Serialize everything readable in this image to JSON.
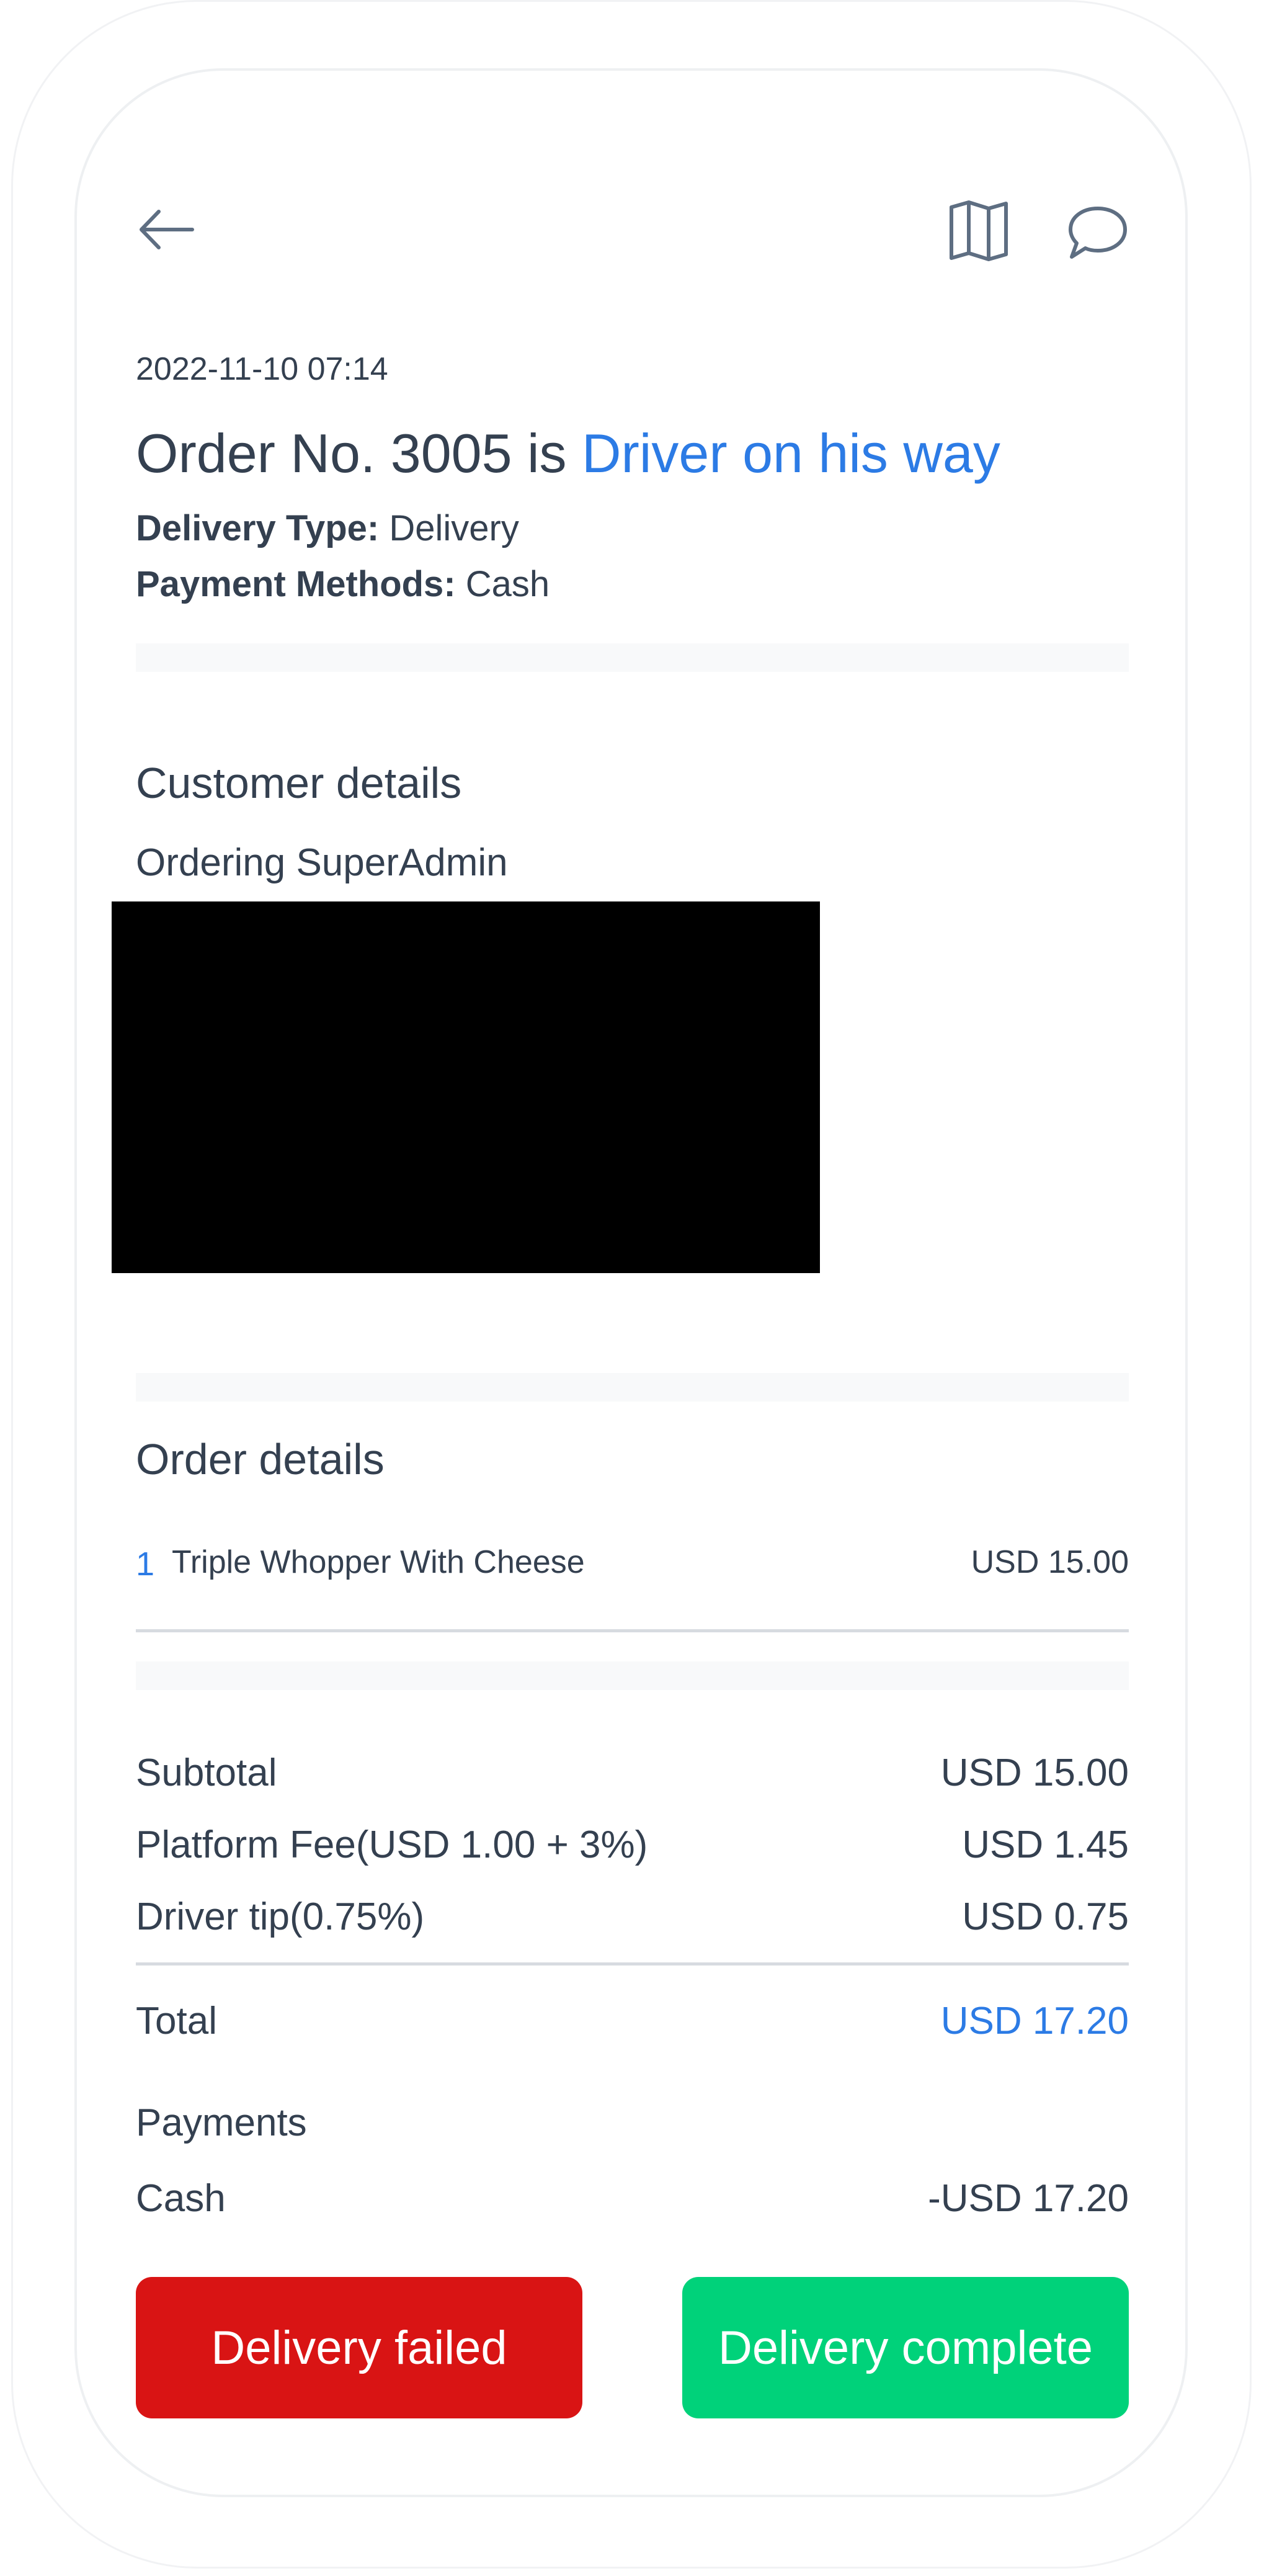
{
  "header": {
    "back_icon": "arrow-left-icon",
    "map_icon": "map-icon",
    "chat_icon": "message-circle-icon"
  },
  "order": {
    "timestamp": "2022-11-10 07:14",
    "title_prefix": "Order No. 3005 is ",
    "status": "Driver on his way",
    "delivery_type_label": "Delivery Type:",
    "delivery_type_value": " Delivery",
    "payment_methods_label": "Payment Methods:",
    "payment_methods_value": " Cash"
  },
  "customer": {
    "section_title": "Customer details",
    "name": "Ordering SuperAdmin"
  },
  "order_details": {
    "section_title": "Order details",
    "items": [
      {
        "qty": "1",
        "name": "Triple Whopper With Cheese",
        "price": "USD 15.00"
      }
    ]
  },
  "summary": {
    "subtotal_label": "Subtotal",
    "subtotal_value": "USD 15.00",
    "platform_fee_label": "Platform Fee(USD 1.00 + 3%)",
    "platform_fee_value": "USD 1.45",
    "driver_tip_label": "Driver tip(0.75%)",
    "driver_tip_value": "USD 0.75",
    "total_label": "Total",
    "total_value": "USD 17.20"
  },
  "payments": {
    "section_title": "Payments",
    "method": "Cash",
    "amount": "-USD 17.20"
  },
  "actions": {
    "failed_label": "Delivery failed",
    "complete_label": "Delivery complete"
  },
  "colors": {
    "accent": "#2c7be5",
    "danger": "#d91414",
    "success": "#00d27a",
    "text": "#344050"
  }
}
